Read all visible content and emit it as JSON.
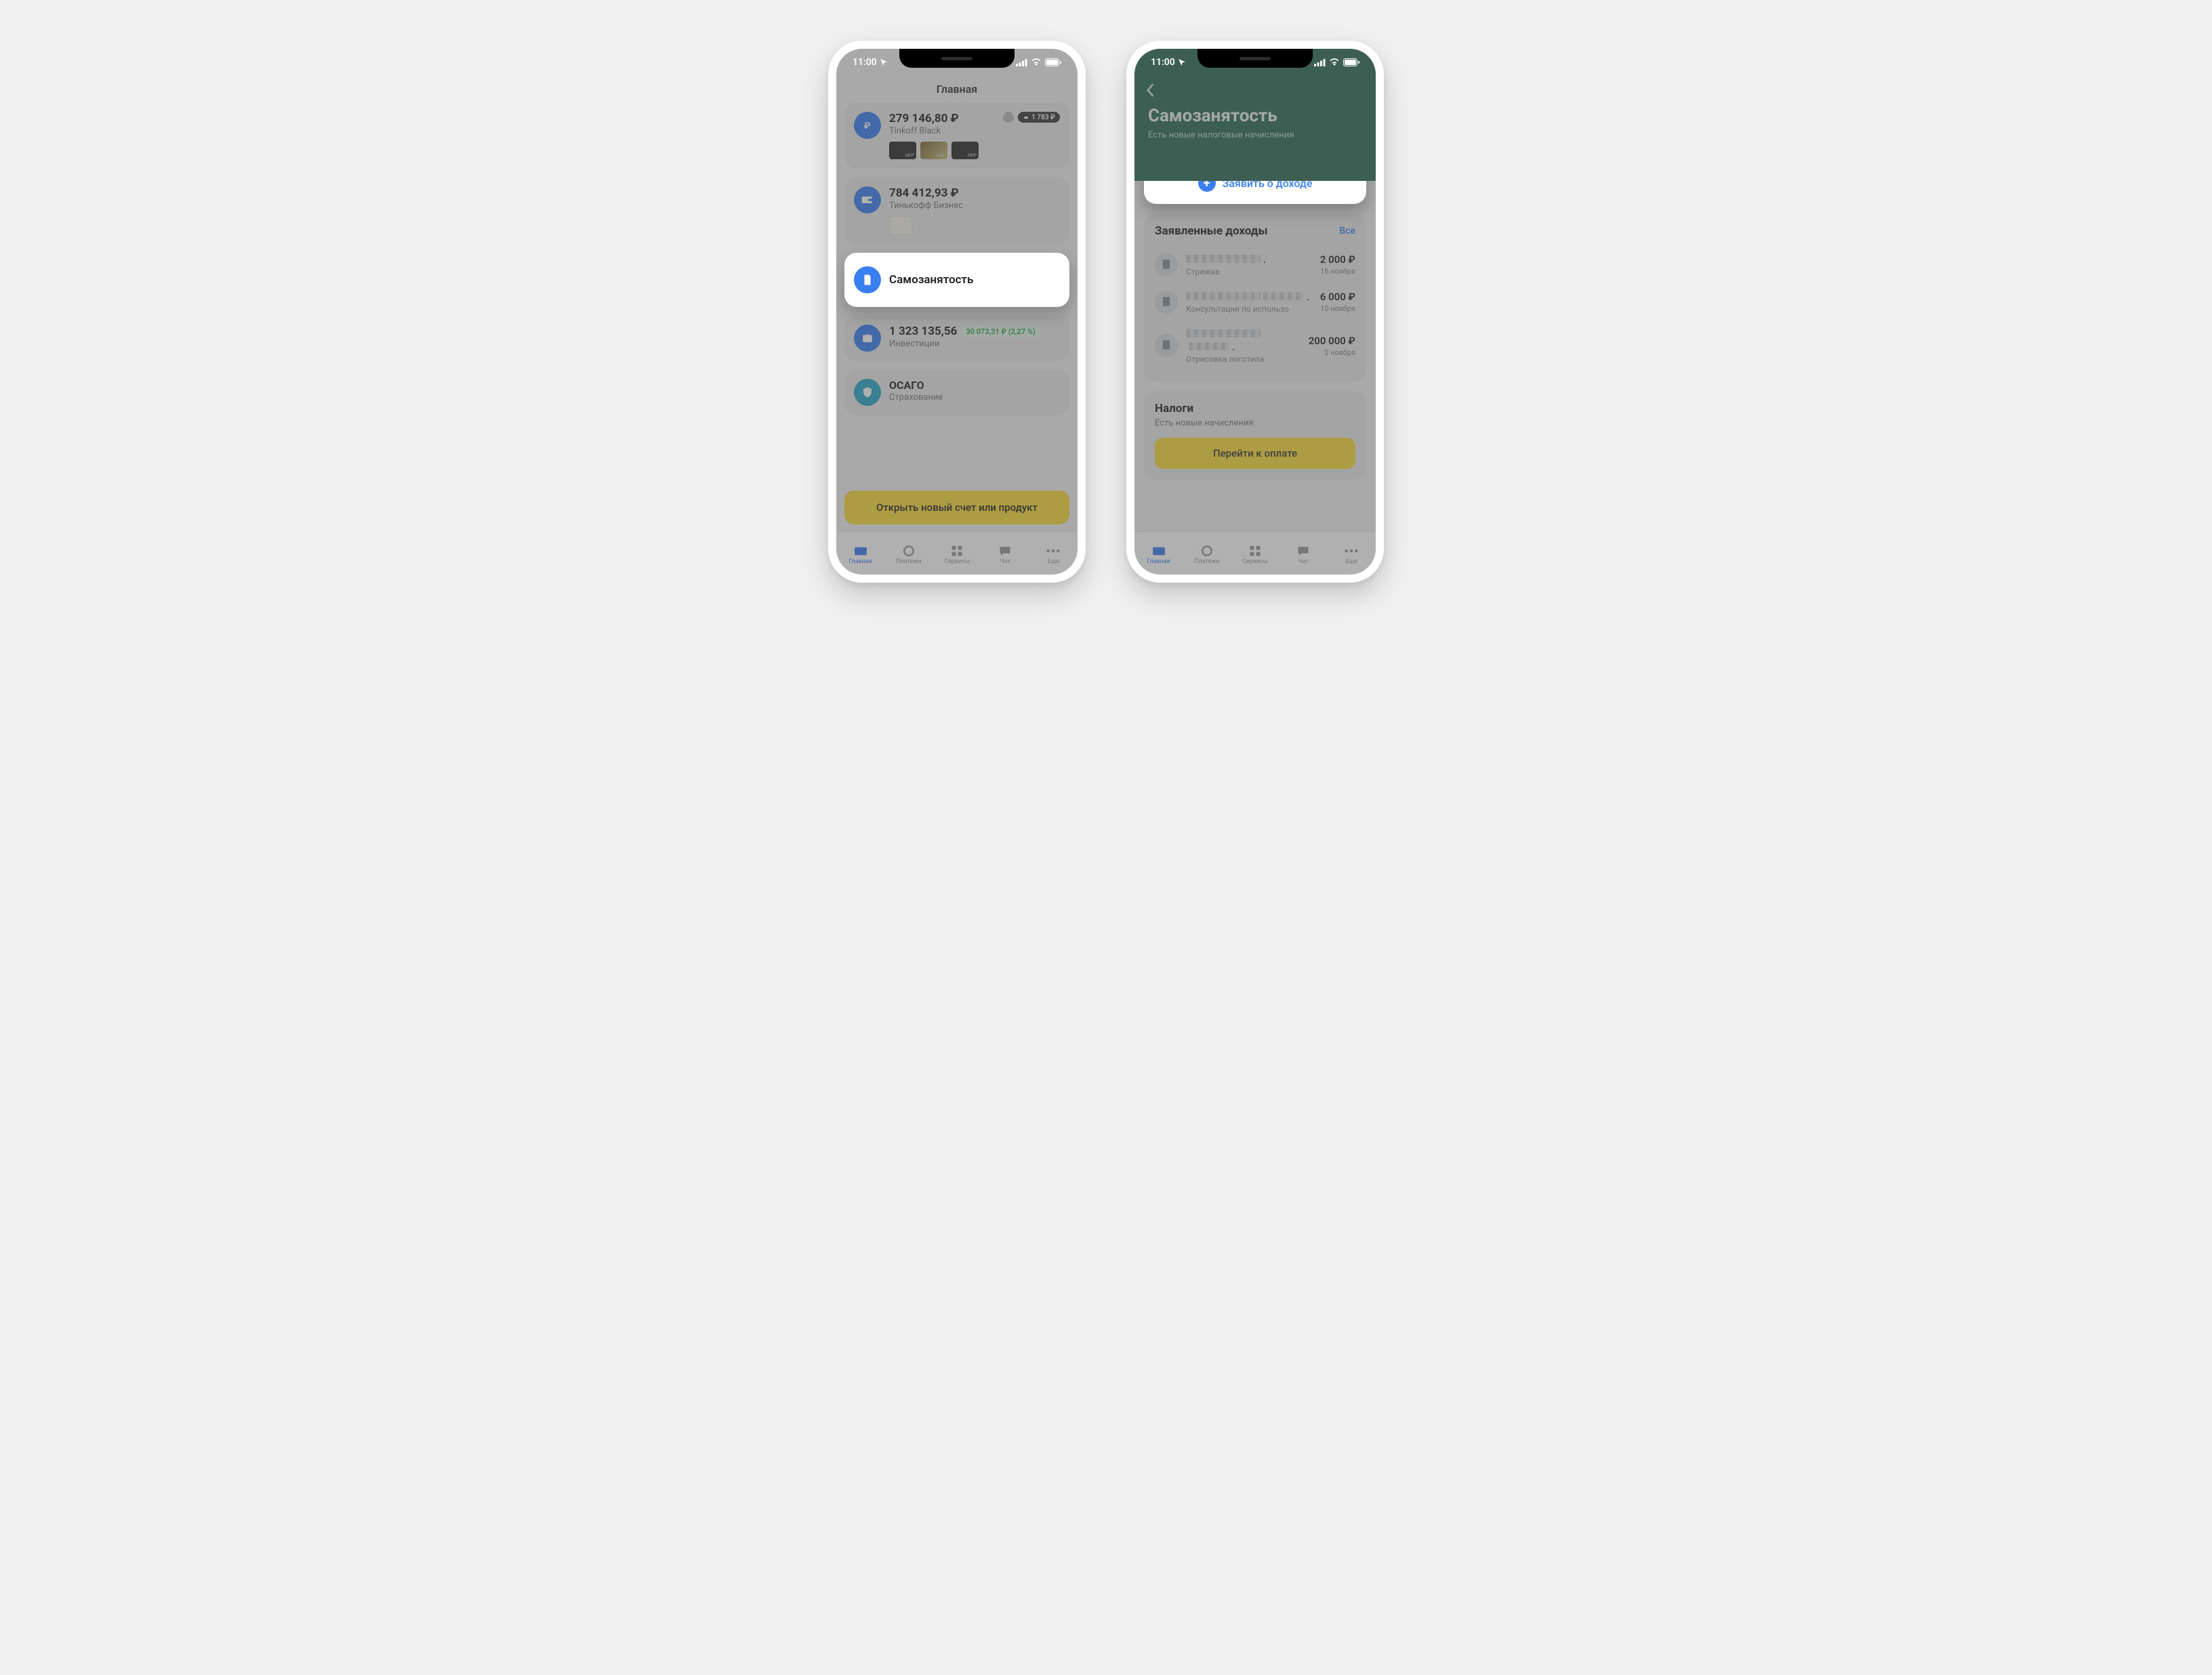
{
  "status_bar": {
    "time": "11:00"
  },
  "phone1": {
    "title": "Главная",
    "accounts": [
      {
        "amount": "279 146,80 ₽",
        "name": "Tinkoff Black",
        "points_badge": "1 783 ₽",
        "icon": "ruble"
      },
      {
        "amount": "784 412,93 ₽",
        "name": "Тинькофф Бизнес",
        "icon": "wallet"
      }
    ],
    "self_employed": {
      "title": "Самозанятость"
    },
    "invest": {
      "amount": "1 323 135,56",
      "name": "Инвестиции",
      "change": "30 073,31 ₽ (2,27 %)"
    },
    "insurance": {
      "title": "ОСАГО",
      "sub": "Страхование"
    },
    "open_button": "Открыть новый счет или продукт"
  },
  "phone2": {
    "title": "Самозанятость",
    "subtitle": "Есть новые налоговые начисления",
    "declare_button": "Заявить о доходе",
    "incomes": {
      "title": "Заявленные доходы",
      "all_link": "Все",
      "items": [
        {
          "desc": "Стрижка",
          "amount": "2 000 ₽",
          "date": "16 ноября"
        },
        {
          "desc": "Консультация по использо",
          "amount": "6 000 ₽",
          "date": "10 ноября"
        },
        {
          "desc": "Отрисовка логотипа",
          "amount": "200 000 ₽",
          "date": "2 ноября"
        }
      ]
    },
    "taxes": {
      "title": "Налоги",
      "sub": "Есть новые начисления",
      "button": "Перейти к оплате"
    }
  },
  "tabs": [
    {
      "label": "Главная",
      "icon": "home"
    },
    {
      "label": "Платежи",
      "icon": "circle"
    },
    {
      "label": "Сервисы",
      "icon": "grid"
    },
    {
      "label": "Чат",
      "icon": "chat"
    },
    {
      "label": "Еще",
      "icon": "dots"
    }
  ]
}
